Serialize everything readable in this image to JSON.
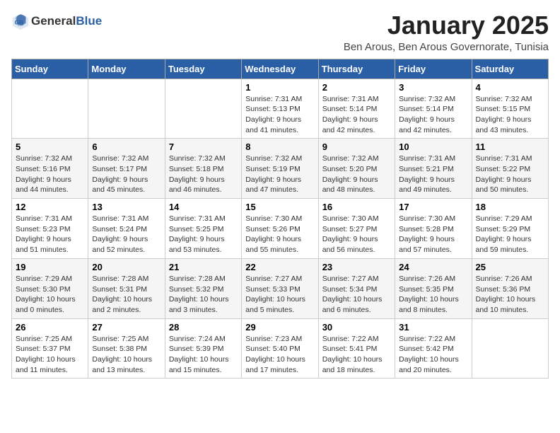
{
  "header": {
    "logo_general": "General",
    "logo_blue": "Blue",
    "month": "January 2025",
    "location": "Ben Arous, Ben Arous Governorate, Tunisia"
  },
  "weekdays": [
    "Sunday",
    "Monday",
    "Tuesday",
    "Wednesday",
    "Thursday",
    "Friday",
    "Saturday"
  ],
  "weeks": [
    [
      {
        "day": "",
        "sunrise": "",
        "sunset": "",
        "daylight": ""
      },
      {
        "day": "",
        "sunrise": "",
        "sunset": "",
        "daylight": ""
      },
      {
        "day": "",
        "sunrise": "",
        "sunset": "",
        "daylight": ""
      },
      {
        "day": "1",
        "sunrise": "Sunrise: 7:31 AM",
        "sunset": "Sunset: 5:13 PM",
        "daylight": "Daylight: 9 hours and 41 minutes."
      },
      {
        "day": "2",
        "sunrise": "Sunrise: 7:31 AM",
        "sunset": "Sunset: 5:14 PM",
        "daylight": "Daylight: 9 hours and 42 minutes."
      },
      {
        "day": "3",
        "sunrise": "Sunrise: 7:32 AM",
        "sunset": "Sunset: 5:14 PM",
        "daylight": "Daylight: 9 hours and 42 minutes."
      },
      {
        "day": "4",
        "sunrise": "Sunrise: 7:32 AM",
        "sunset": "Sunset: 5:15 PM",
        "daylight": "Daylight: 9 hours and 43 minutes."
      }
    ],
    [
      {
        "day": "5",
        "sunrise": "Sunrise: 7:32 AM",
        "sunset": "Sunset: 5:16 PM",
        "daylight": "Daylight: 9 hours and 44 minutes."
      },
      {
        "day": "6",
        "sunrise": "Sunrise: 7:32 AM",
        "sunset": "Sunset: 5:17 PM",
        "daylight": "Daylight: 9 hours and 45 minutes."
      },
      {
        "day": "7",
        "sunrise": "Sunrise: 7:32 AM",
        "sunset": "Sunset: 5:18 PM",
        "daylight": "Daylight: 9 hours and 46 minutes."
      },
      {
        "day": "8",
        "sunrise": "Sunrise: 7:32 AM",
        "sunset": "Sunset: 5:19 PM",
        "daylight": "Daylight: 9 hours and 47 minutes."
      },
      {
        "day": "9",
        "sunrise": "Sunrise: 7:32 AM",
        "sunset": "Sunset: 5:20 PM",
        "daylight": "Daylight: 9 hours and 48 minutes."
      },
      {
        "day": "10",
        "sunrise": "Sunrise: 7:31 AM",
        "sunset": "Sunset: 5:21 PM",
        "daylight": "Daylight: 9 hours and 49 minutes."
      },
      {
        "day": "11",
        "sunrise": "Sunrise: 7:31 AM",
        "sunset": "Sunset: 5:22 PM",
        "daylight": "Daylight: 9 hours and 50 minutes."
      }
    ],
    [
      {
        "day": "12",
        "sunrise": "Sunrise: 7:31 AM",
        "sunset": "Sunset: 5:23 PM",
        "daylight": "Daylight: 9 hours and 51 minutes."
      },
      {
        "day": "13",
        "sunrise": "Sunrise: 7:31 AM",
        "sunset": "Sunset: 5:24 PM",
        "daylight": "Daylight: 9 hours and 52 minutes."
      },
      {
        "day": "14",
        "sunrise": "Sunrise: 7:31 AM",
        "sunset": "Sunset: 5:25 PM",
        "daylight": "Daylight: 9 hours and 53 minutes."
      },
      {
        "day": "15",
        "sunrise": "Sunrise: 7:30 AM",
        "sunset": "Sunset: 5:26 PM",
        "daylight": "Daylight: 9 hours and 55 minutes."
      },
      {
        "day": "16",
        "sunrise": "Sunrise: 7:30 AM",
        "sunset": "Sunset: 5:27 PM",
        "daylight": "Daylight: 9 hours and 56 minutes."
      },
      {
        "day": "17",
        "sunrise": "Sunrise: 7:30 AM",
        "sunset": "Sunset: 5:28 PM",
        "daylight": "Daylight: 9 hours and 57 minutes."
      },
      {
        "day": "18",
        "sunrise": "Sunrise: 7:29 AM",
        "sunset": "Sunset: 5:29 PM",
        "daylight": "Daylight: 9 hours and 59 minutes."
      }
    ],
    [
      {
        "day": "19",
        "sunrise": "Sunrise: 7:29 AM",
        "sunset": "Sunset: 5:30 PM",
        "daylight": "Daylight: 10 hours and 0 minutes."
      },
      {
        "day": "20",
        "sunrise": "Sunrise: 7:28 AM",
        "sunset": "Sunset: 5:31 PM",
        "daylight": "Daylight: 10 hours and 2 minutes."
      },
      {
        "day": "21",
        "sunrise": "Sunrise: 7:28 AM",
        "sunset": "Sunset: 5:32 PM",
        "daylight": "Daylight: 10 hours and 3 minutes."
      },
      {
        "day": "22",
        "sunrise": "Sunrise: 7:27 AM",
        "sunset": "Sunset: 5:33 PM",
        "daylight": "Daylight: 10 hours and 5 minutes."
      },
      {
        "day": "23",
        "sunrise": "Sunrise: 7:27 AM",
        "sunset": "Sunset: 5:34 PM",
        "daylight": "Daylight: 10 hours and 6 minutes."
      },
      {
        "day": "24",
        "sunrise": "Sunrise: 7:26 AM",
        "sunset": "Sunset: 5:35 PM",
        "daylight": "Daylight: 10 hours and 8 minutes."
      },
      {
        "day": "25",
        "sunrise": "Sunrise: 7:26 AM",
        "sunset": "Sunset: 5:36 PM",
        "daylight": "Daylight: 10 hours and 10 minutes."
      }
    ],
    [
      {
        "day": "26",
        "sunrise": "Sunrise: 7:25 AM",
        "sunset": "Sunset: 5:37 PM",
        "daylight": "Daylight: 10 hours and 11 minutes."
      },
      {
        "day": "27",
        "sunrise": "Sunrise: 7:25 AM",
        "sunset": "Sunset: 5:38 PM",
        "daylight": "Daylight: 10 hours and 13 minutes."
      },
      {
        "day": "28",
        "sunrise": "Sunrise: 7:24 AM",
        "sunset": "Sunset: 5:39 PM",
        "daylight": "Daylight: 10 hours and 15 minutes."
      },
      {
        "day": "29",
        "sunrise": "Sunrise: 7:23 AM",
        "sunset": "Sunset: 5:40 PM",
        "daylight": "Daylight: 10 hours and 17 minutes."
      },
      {
        "day": "30",
        "sunrise": "Sunrise: 7:22 AM",
        "sunset": "Sunset: 5:41 PM",
        "daylight": "Daylight: 10 hours and 18 minutes."
      },
      {
        "day": "31",
        "sunrise": "Sunrise: 7:22 AM",
        "sunset": "Sunset: 5:42 PM",
        "daylight": "Daylight: 10 hours and 20 minutes."
      },
      {
        "day": "",
        "sunrise": "",
        "sunset": "",
        "daylight": ""
      }
    ]
  ]
}
